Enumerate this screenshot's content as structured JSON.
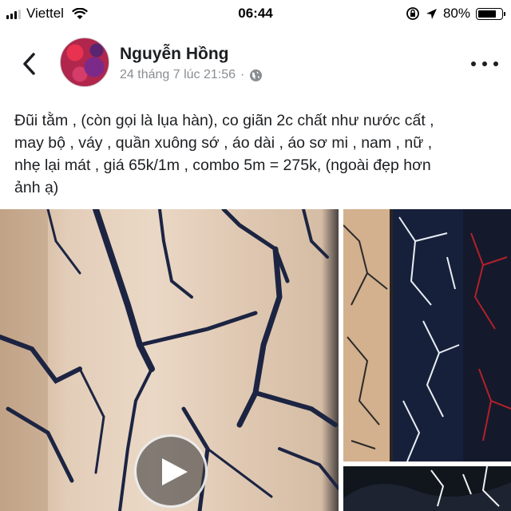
{
  "status_bar": {
    "carrier": "Viettel",
    "time": "06:44",
    "battery": "80%",
    "battery_level": 0.8,
    "signal_bars": 3,
    "icons": [
      "signal-icon",
      "wifi-icon",
      "rotation-lock-icon",
      "location-icon",
      "battery-icon"
    ]
  },
  "header": {
    "back_icon": "chevron-left-icon",
    "author_name": "Nguyễn Hồng",
    "timestamp": "24 tháng 7 lúc 21:56",
    "separator": "·",
    "privacy_icon": "globe-icon",
    "more_icon": "more-horizontal-icon"
  },
  "post": {
    "text_lines": [
      "Đũi tằm , (còn gọi là lụa hàn), co giãn 2c chất như nước cất ,",
      "may bộ , váy , quần xuông sớ , áo dài , áo sơ mi , nam , nữ ,",
      "nhẹ lại mát , giá 65k/1m , combo 5m = 275k, (ngoài đẹp hơn",
      "ảnh ạ)"
    ]
  },
  "media": {
    "main": {
      "type": "video",
      "play_icon": "play-icon"
    },
    "side_items": 2
  },
  "colors": {
    "text": "#1c1e21",
    "meta": "#8a8d91",
    "fabric_beige": "#d9c3ac",
    "fabric_navy": "#1a2238",
    "fabric_red": "#b3202a"
  }
}
